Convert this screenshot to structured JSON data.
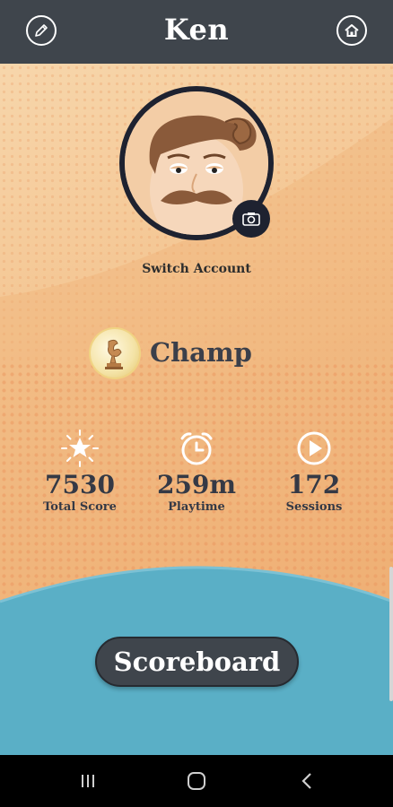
{
  "header": {
    "title": "Ken",
    "edit_icon": "pencil-icon",
    "home_icon": "home-icon"
  },
  "profile": {
    "avatar": "mustache-man-avatar",
    "camera_icon": "camera-icon",
    "switch_account_label": "Switch Account"
  },
  "rank": {
    "badge_icon": "trophy-badge-icon",
    "label": "Champ"
  },
  "stats": [
    {
      "icon": "star-burst-icon",
      "value": "7530",
      "label": "Total Score"
    },
    {
      "icon": "alarm-clock-icon",
      "value": "259m",
      "label": "Playtime"
    },
    {
      "icon": "play-circle-icon",
      "value": "172",
      "label": "Sessions"
    }
  ],
  "actions": {
    "scoreboard_label": "Scoreboard"
  },
  "navbar": {
    "recents_icon": "recents-icon",
    "home_icon": "circle-home-icon",
    "back_icon": "back-chevron-icon"
  },
  "colors": {
    "header": "#3f454c",
    "background_orange": "#f3c08a",
    "wave_blue": "#5aafc6",
    "avatar_ring": "#1e2230"
  }
}
